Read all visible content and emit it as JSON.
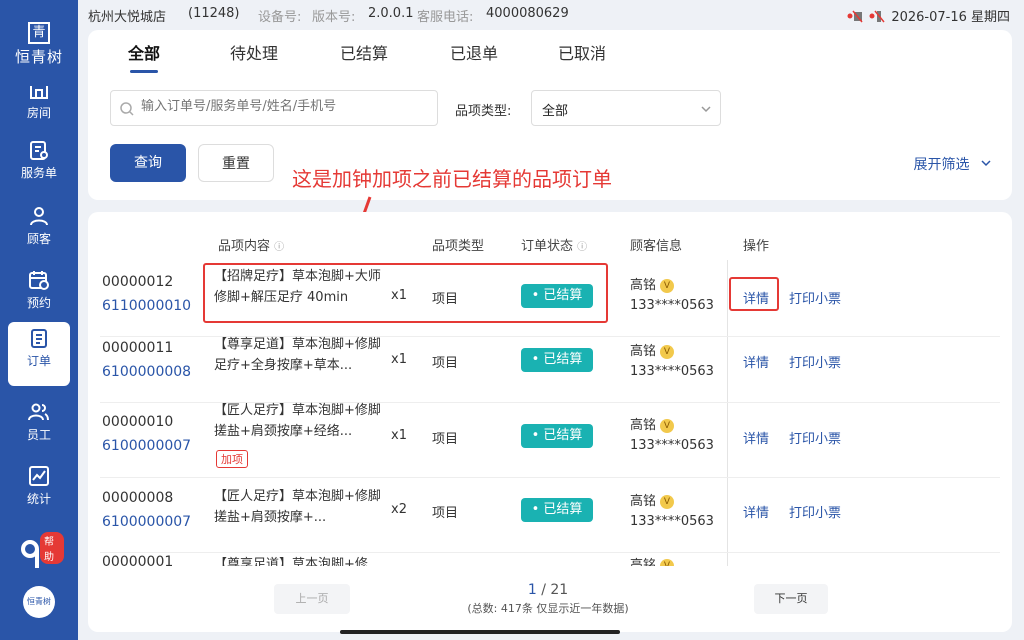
{
  "sidebar": {
    "logo_char": "青",
    "logo_text": "恒青树",
    "items": [
      {
        "label": "房间",
        "icon": "room-icon"
      },
      {
        "label": "服务单",
        "icon": "service-order-icon"
      },
      {
        "label": "顾客",
        "icon": "customer-icon"
      },
      {
        "label": "预约",
        "icon": "calendar-icon"
      },
      {
        "label": "订单",
        "icon": "order-icon"
      },
      {
        "label": "员工",
        "icon": "staff-icon"
      },
      {
        "label": "统计",
        "icon": "chart-icon"
      }
    ],
    "active": "订单",
    "help_badge": "帮助",
    "brand_logo_text": "恒青树"
  },
  "statusbar": {
    "store_name": "杭州大悦城店",
    "store_code": "(11248)",
    "device_label": "设备号:",
    "version_label": "版本号:",
    "version": "2.0.0.1",
    "hotline_label": "客服电话:",
    "hotline": "4000080629",
    "datetime": "2026-07-16 星期四"
  },
  "filter": {
    "tabs": [
      "全部",
      "待处理",
      "已结算",
      "已退单",
      "已取消"
    ],
    "active_tab": "全部",
    "search_placeholder": "输入订单号/服务单号/姓名/手机号",
    "type_label": "品项类型:",
    "type_value": "全部",
    "query_button": "查询",
    "reset_button": "重置",
    "expand_label": "展开筛选"
  },
  "annotation": "这是加钟加项之前已结算的品项订单",
  "table": {
    "headers": {
      "content": "品项内容",
      "type": "品项类型",
      "status": "订单状态",
      "customer": "顾客信息",
      "action": "操作"
    },
    "rows": [
      {
        "id": "00000012",
        "sub_id": "6110000010",
        "content": "【招牌足疗】草本泡脚+大师修脚+解压足疗 40min",
        "qty": "x1",
        "type": "项目",
        "status": "已结算",
        "customer": "高铭",
        "phone": "133****0563",
        "tag": ""
      },
      {
        "id": "00000011",
        "sub_id": "6100000008",
        "content": "【尊享足道】草本泡脚+修脚足疗+全身按摩+草本...",
        "qty": "x1",
        "type": "项目",
        "status": "已结算",
        "customer": "高铭",
        "phone": "133****0563",
        "tag": ""
      },
      {
        "id": "00000010",
        "sub_id": "6100000007",
        "content": "【匠人足疗】草本泡脚+修脚搓盐+肩颈按摩+经络...",
        "qty": "x1",
        "type": "项目",
        "status": "已结算",
        "customer": "高铭",
        "phone": "133****0563",
        "tag": "加项"
      },
      {
        "id": "00000008",
        "sub_id": "6100000007",
        "content": "【匠人足疗】草本泡脚+修脚搓盐+肩颈按摩+...",
        "qty": "x2",
        "type": "项目",
        "status": "已结算",
        "customer": "高铭",
        "phone": "133****0563",
        "tag": ""
      },
      {
        "id": "00000001",
        "sub_id": "",
        "content": "【尊享足道】草本泡脚+修",
        "qty": "",
        "type": "",
        "status": "",
        "customer": "高铭",
        "phone": "",
        "tag": ""
      }
    ],
    "actions": {
      "detail": "详情",
      "print": "打印小票"
    }
  },
  "pagination": {
    "prev": "上一页",
    "next": "下一页",
    "current": "1",
    "separator": "/",
    "total_pages": "21",
    "total_text": "(总数: 417条 仅显示近一年数据)"
  },
  "colors": {
    "primary": "#2a55a8",
    "status_badge": "#1ab2b2",
    "annotation": "#e53935"
  }
}
